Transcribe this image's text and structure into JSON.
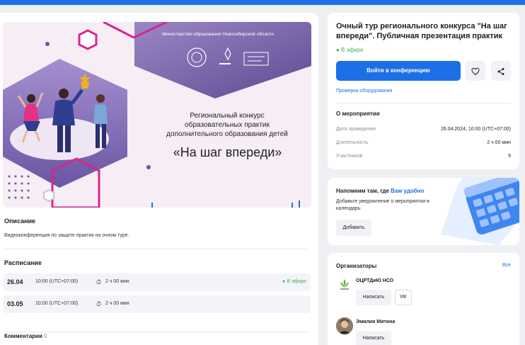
{
  "banner": {
    "ministry": "Министерство образования Новосибирской области",
    "subtitle_line1": "Региональный конкурс",
    "subtitle_line2": "образовательных практик",
    "subtitle_line3": "дополнительного образования детей",
    "title": "«На шаг впереди»"
  },
  "description": {
    "heading": "Описание",
    "text": "Видеоконференция по защите практик на очном туре."
  },
  "schedule": {
    "heading": "Расписание",
    "rows": [
      {
        "date": "26.04",
        "time": "10:00 (UTC+07:00)",
        "duration": "2 ч 00 мин",
        "status": "● В эфире"
      },
      {
        "date": "03.05",
        "time": "10:00 (UTC+07:00)",
        "duration": "2 ч 00 мин",
        "status": ""
      }
    ]
  },
  "comments": {
    "label": "Комментарии",
    "count": "0"
  },
  "event": {
    "title": "Очный тур регионального конкурса \"На шаг впереди\". Публичная презентация практик",
    "live": "● В эфире",
    "join_label": "Войти в конференцию",
    "check_label": "Проверка оборудования",
    "about_heading": "О мероприятии",
    "details": [
      {
        "key": "Дата проведения",
        "value": "26.04.2024, 10:00 (UTC+07:00)"
      },
      {
        "key": "Длительность",
        "value": "2 ч 00 мин"
      },
      {
        "key": "Участников",
        "value": "9"
      }
    ]
  },
  "reminder": {
    "title_part1": "Напомним там, где ",
    "title_part2": "Вам удобно",
    "text": "Добавьте уведомление о мероприятии в календарь",
    "button": "Добавить"
  },
  "organizers": {
    "heading": "Организаторы",
    "all_label": "Все",
    "org_name": "ОЦРТДиЮ НСО",
    "write_label": "Написать",
    "vk_label": "VK",
    "person_name": "Эмилия Митина"
  },
  "colors": {
    "accent": "#1d6fe8",
    "live": "#3cb457",
    "banner_purple": "#7b5ea7",
    "banner_pink": "#d6258f"
  },
  "icons": {
    "like": "heart-icon",
    "share": "share-icon",
    "timer": "timer-icon"
  }
}
